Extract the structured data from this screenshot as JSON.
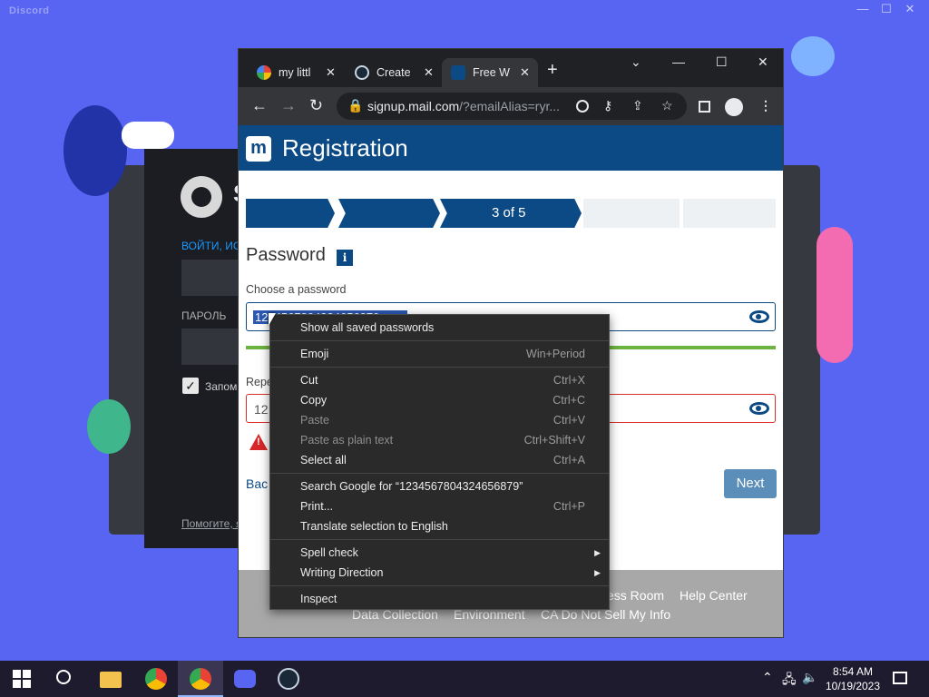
{
  "discord": {
    "title": "Discord",
    "controls": [
      "—",
      "☐",
      "✕"
    ]
  },
  "steam": {
    "logo_text": "S",
    "login_label": "ВОЙТИ, ИС",
    "password_label": "ПАРОЛЬ",
    "remember_label": "Запом",
    "help_link": "Помогите, я"
  },
  "browser": {
    "tabs": [
      {
        "title": "my littl",
        "close": "✕"
      },
      {
        "title": "Create",
        "close": "✕"
      },
      {
        "title": "Free W",
        "close": "✕"
      }
    ],
    "new_tab": "+",
    "window_controls": {
      "dropdown": "⌄",
      "minimize": "—",
      "maximize": "☐",
      "close": "✕"
    },
    "nav": {
      "back": "←",
      "forward": "→",
      "reload": "↻"
    },
    "url_host": "signup.mail.com",
    "url_path": "/?emailAlias=ryr..."
  },
  "page": {
    "logo": "m",
    "header_title": "Registration",
    "step_label": "3 of 5",
    "password_section_title": "Password",
    "info_badge": "i",
    "choose_label": "Choose a password",
    "password_value": "1234567804324656879",
    "repeat_label": "Repe",
    "repeat_value": "12",
    "back_link": "Bac",
    "next_button": "Next",
    "footer_links": [
      "ess Room",
      "Help Center",
      "Data Collection",
      "Environment",
      "CA Do Not Sell My Info"
    ]
  },
  "context_menu": {
    "items": [
      {
        "label": "Show all saved passwords",
        "shortcut": ""
      },
      {
        "label": "Emoji",
        "shortcut": "Win+Period"
      },
      {
        "label": "Cut",
        "shortcut": "Ctrl+X"
      },
      {
        "label": "Copy",
        "shortcut": "Ctrl+C"
      },
      {
        "label": "Paste",
        "shortcut": "Ctrl+V"
      },
      {
        "label": "Paste as plain text",
        "shortcut": "Ctrl+Shift+V"
      },
      {
        "label": "Select all",
        "shortcut": "Ctrl+A"
      },
      {
        "label": "Search Google for “1234567804324656879”",
        "shortcut": ""
      },
      {
        "label": "Print...",
        "shortcut": "Ctrl+P"
      },
      {
        "label": "Translate selection to English",
        "shortcut": ""
      },
      {
        "label": "Spell check",
        "shortcut": ""
      },
      {
        "label": "Writing Direction",
        "shortcut": ""
      },
      {
        "label": "Inspect",
        "shortcut": ""
      }
    ],
    "submenu_arrow": "▶"
  },
  "taskbar": {
    "time": "8:54 AM",
    "date": "10/19/2023"
  },
  "colors": {
    "desktop": "#5865f2",
    "mail_blue": "#0b4a85",
    "strength_green": "#6cb33f",
    "error_red": "#d9302b"
  }
}
